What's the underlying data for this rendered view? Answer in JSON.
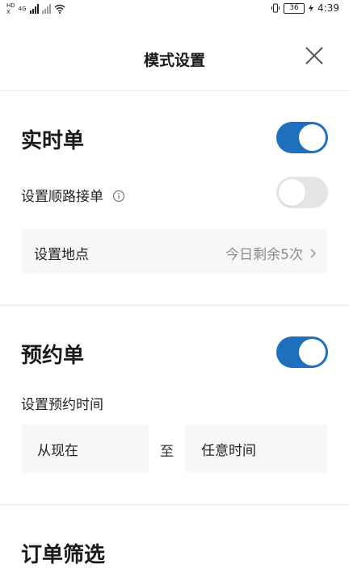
{
  "status_bar": {
    "hd_top": "HD",
    "hd_bottom": "X",
    "network": "4G",
    "battery": "36",
    "time": "4:39"
  },
  "header": {
    "title": "模式设置"
  },
  "realtime": {
    "title": "实时单",
    "enabled": true,
    "along_route_label": "设置顺路接单",
    "along_route_enabled": false,
    "location_label": "设置地点",
    "location_remaining": "今日剩余5次"
  },
  "reservation": {
    "title": "预约单",
    "enabled": true,
    "time_label": "设置预约时间",
    "from": "从现在",
    "to_separator": "至",
    "to": "任意时间"
  },
  "filter": {
    "title": "订单筛选"
  },
  "colors": {
    "toggle_on": "#1f6fbf",
    "toggle_off": "#e5e5e6"
  }
}
